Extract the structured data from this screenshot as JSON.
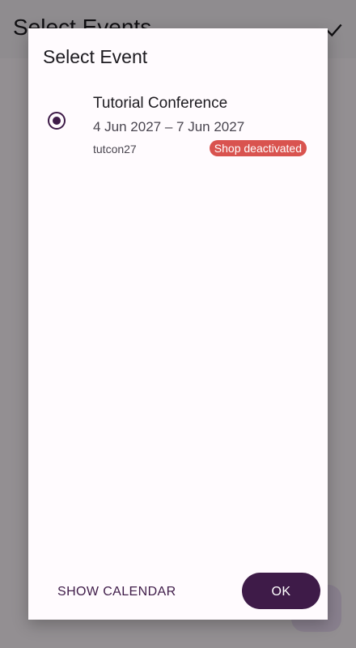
{
  "background": {
    "title": "Select Events",
    "confirm_icon": "check-icon"
  },
  "dialog": {
    "title": "Select Event",
    "events": [
      {
        "name": "Tutorial Conference",
        "dates": "4 Jun 2027 – 7 Jun 2027",
        "slug": "tutcon27",
        "status": "Shop deactivated",
        "selected": true
      }
    ],
    "buttons": {
      "show_calendar": "SHOW CALENDAR",
      "ok": "OK"
    }
  },
  "colors": {
    "primary": "#3e1b48",
    "status_badge": "#d9534f",
    "dialog_surface": "#fffbfe"
  }
}
